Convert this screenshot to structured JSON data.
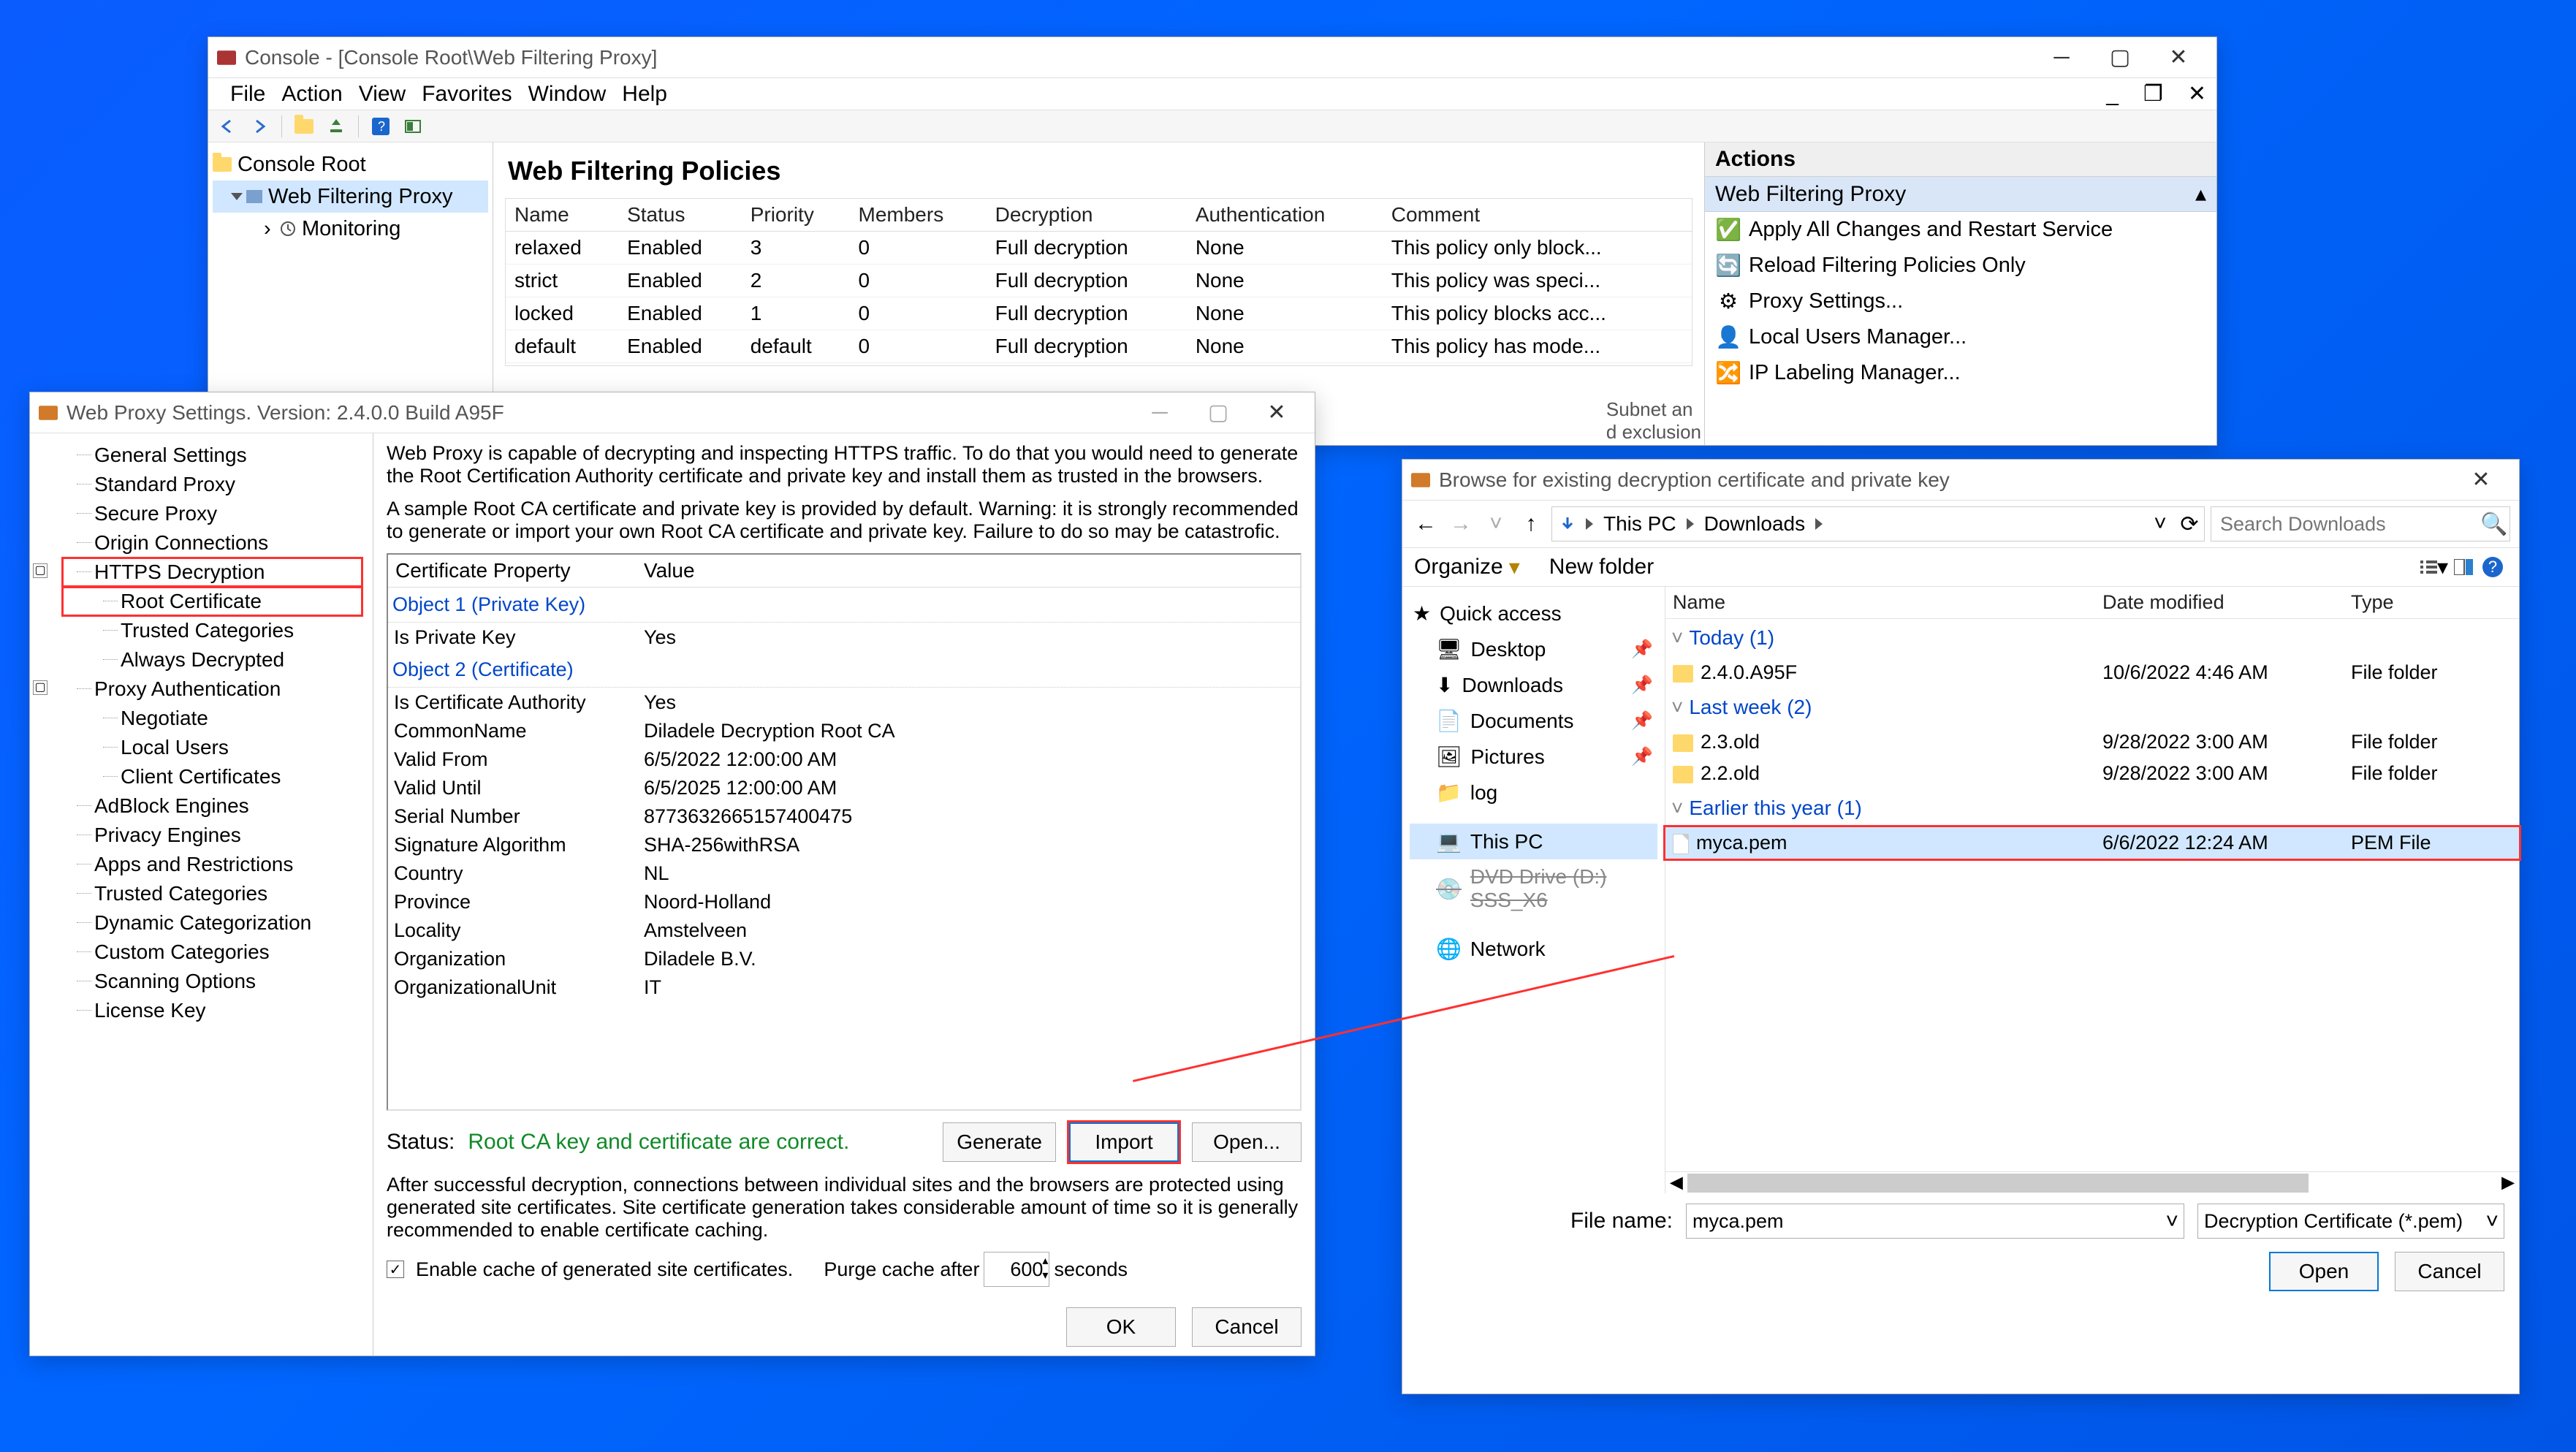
{
  "console": {
    "title": "Console - [Console Root\\Web Filtering Proxy]",
    "menus": [
      "File",
      "Action",
      "View",
      "Favorites",
      "Window",
      "Help"
    ],
    "tree": {
      "root": "Console Root",
      "proxy": "Web Filtering Proxy",
      "monitoring": "Monitoring"
    },
    "policies_title": "Web Filtering Policies",
    "cols": [
      "Name",
      "Status",
      "Priority",
      "Members",
      "Decryption",
      "Authentication",
      "Comment"
    ],
    "rows": [
      {
        "name": "relaxed",
        "status": "Enabled",
        "priority": "3",
        "members": "0",
        "decryption": "Full decryption",
        "auth": "None",
        "comment": "This policy only block..."
      },
      {
        "name": "strict",
        "status": "Enabled",
        "priority": "2",
        "members": "0",
        "decryption": "Full decryption",
        "auth": "None",
        "comment": "This policy was speci..."
      },
      {
        "name": "locked",
        "status": "Enabled",
        "priority": "1",
        "members": "0",
        "decryption": "Full decryption",
        "auth": "None",
        "comment": "This policy blocks acc..."
      },
      {
        "name": "default",
        "status": "Enabled",
        "priority": "default",
        "members": "0",
        "decryption": "Full decryption",
        "auth": "None",
        "comment": "This policy has mode..."
      }
    ],
    "truncated_info": " Subnet an\nd exclusion",
    "actions": {
      "header": "Actions",
      "subheader": "Web Filtering Proxy",
      "items": [
        "Apply All Changes and Restart Service",
        "Reload Filtering Policies Only",
        "Proxy Settings...",
        "Local Users Manager...",
        "IP Labeling Manager..."
      ]
    }
  },
  "settings": {
    "title": "Web Proxy Settings. Version: 2.4.0.0 Build A95F",
    "tree": [
      "General Settings",
      "Standard Proxy",
      "Secure Proxy",
      "Origin Connections",
      {
        "label": "HTTPS Decryption",
        "children": [
          "Root Certificate",
          "Trusted Categories",
          "Always Decrypted"
        ],
        "highlight": "Root Certificate",
        "box": true
      },
      {
        "label": "Proxy Authentication",
        "children": [
          "Negotiate",
          "Local Users",
          "Client Certificates"
        ]
      },
      "AdBlock Engines",
      "Privacy Engines",
      "Apps and Restrictions",
      "Trusted Categories",
      "Dynamic Categorization",
      "Custom Categories",
      "Scanning Options",
      "License Key"
    ],
    "desc1": "Web Proxy is capable of decrypting and inspecting HTTPS traffic. To do that you would need to generate the Root Certification Authority certificate and private key and install them as trusted in the browsers.",
    "desc2": "A sample Root CA certificate and private key is provided by default. Warning: it is strongly recommended to generate or import your own Root CA certificate and private key. Failure to do so may be catastrofic.",
    "prop_header": [
      "Certificate Property",
      "Value"
    ],
    "section1": "Object 1 (Private Key)",
    "privkey_label": "Is Private Key",
    "privkey_val": "Yes",
    "section2": "Object 2 (Certificate)",
    "props": [
      [
        "Is Certificate Authority",
        "Yes"
      ],
      [
        "CommonName",
        "Diladele Decryption Root CA"
      ],
      [
        "Valid From",
        "6/5/2022 12:00:00 AM"
      ],
      [
        "Valid Until",
        "6/5/2025 12:00:00 AM"
      ],
      [
        "Serial Number",
        "8773632665157400475"
      ],
      [
        "Signature Algorithm",
        "SHA-256withRSA"
      ],
      [
        "Country",
        "NL"
      ],
      [
        "Province",
        "Noord-Holland"
      ],
      [
        "Locality",
        "Amstelveen"
      ],
      [
        "Organization",
        "Diladele B.V."
      ],
      [
        "OrganizationalUnit",
        "IT"
      ]
    ],
    "status_label": "Status:",
    "status_text": "Root CA key and certificate are correct.",
    "btn_generate": "Generate",
    "btn_import": "Import",
    "btn_opendots": "Open...",
    "desc3": "After successful decryption, connections between individual sites and the browsers are protected using generated site certificates. Site certificate generation takes considerable amount of time so it is generally recommended to enable certificate caching.",
    "cache_label": "Enable cache of generated site certificates.",
    "purge_label": "Purge cache after",
    "purge_val": "600",
    "purge_unit": "seconds",
    "btn_ok": "OK",
    "btn_cancel": "Cancel"
  },
  "browse": {
    "title": "Browse for existing decryption certificate and private key",
    "crumbs": [
      "This PC",
      "Downloads"
    ],
    "search_placeholder": "Search Downloads",
    "organize": "Organize",
    "newfolder": "New folder",
    "nav": [
      "Quick access",
      "Desktop",
      "Downloads",
      "Documents",
      "Pictures",
      "log",
      "This PC",
      "DVD Drive (D:) SSS_X6",
      "Network"
    ],
    "cols": [
      "Name",
      "Date modified",
      "Type"
    ],
    "groups": [
      {
        "title": "Today  (1)",
        "rows": [
          {
            "name": "2.4.0.A95F",
            "date": "10/6/2022 4:46 AM",
            "type": "File folder",
            "folder": true
          }
        ]
      },
      {
        "title": "Last week  (2)",
        "rows": [
          {
            "name": "2.3.old",
            "date": "9/28/2022 3:00 AM",
            "type": "File folder",
            "folder": true
          },
          {
            "name": "2.2.old",
            "date": "9/28/2022 3:00 AM",
            "type": "File folder",
            "folder": true
          }
        ]
      },
      {
        "title": "Earlier this year  (1)",
        "rows": [
          {
            "name": "myca.pem",
            "date": "6/6/2022 12:24 AM",
            "type": "PEM File",
            "folder": false,
            "highlight": true
          }
        ]
      }
    ],
    "filename_label": "File name:",
    "filename_value": "myca.pem",
    "filter": "Decryption Certificate (*.pem)",
    "btn_open": "Open",
    "btn_cancel": "Cancel"
  }
}
